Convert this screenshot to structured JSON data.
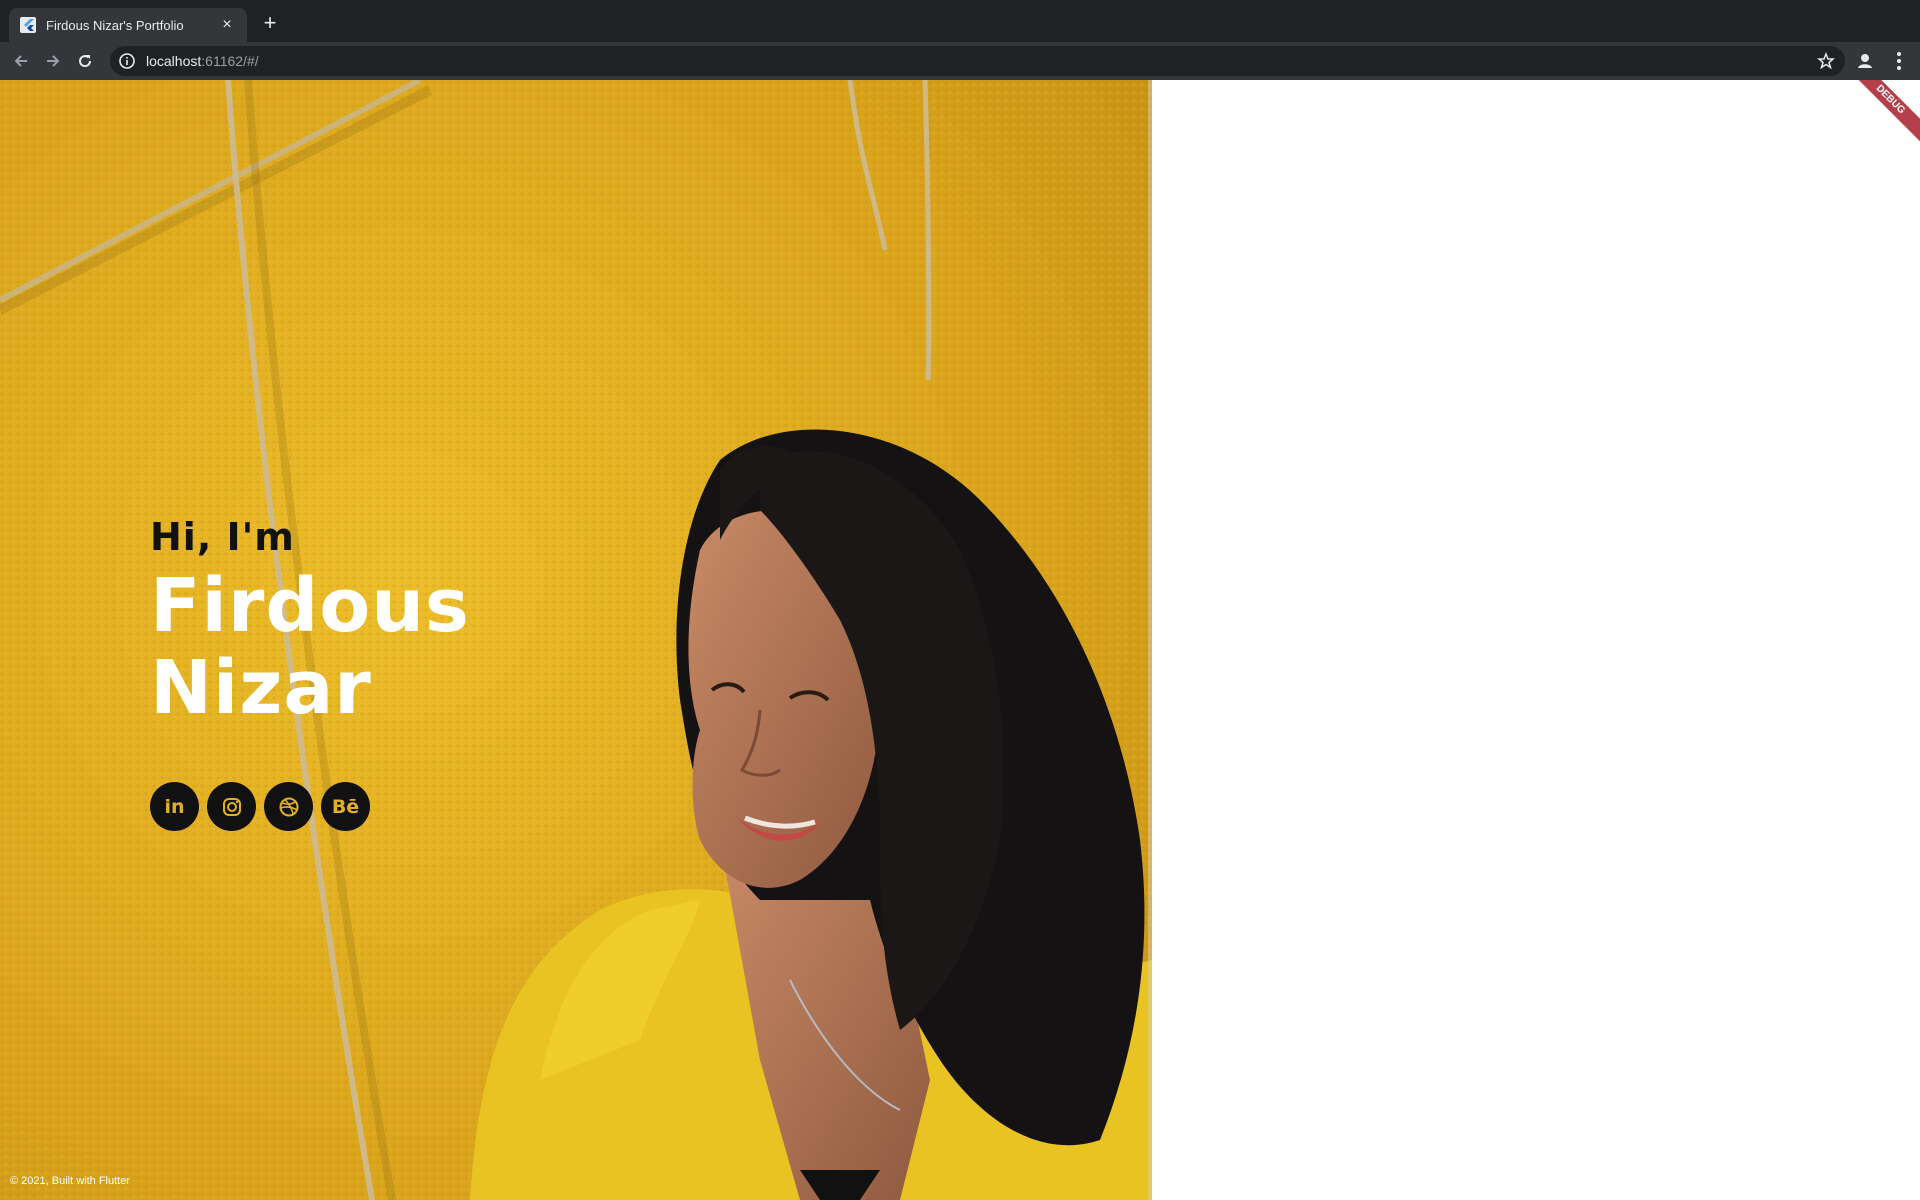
{
  "browser": {
    "tab_title": "Firdous Nizar's Portfolio",
    "tab_close": "×",
    "new_tab": "+",
    "url_host": "localhost",
    "url_rest": ":61162/#/"
  },
  "hero": {
    "greeting": "Hi, I'm",
    "first_name": "Firdous",
    "last_name": "Nizar",
    "socials": [
      {
        "label": "in",
        "icon": "linkedin-icon"
      },
      {
        "label": "",
        "icon": "instagram-icon"
      },
      {
        "label": "",
        "icon": "dribbble-icon"
      },
      {
        "label": "Bē",
        "icon": "behance-icon"
      }
    ]
  },
  "footer": {
    "text": "© 2021, Built with Flutter"
  },
  "debug_banner": "DEBUG",
  "colors": {
    "accent_yellow": "#e0ad1f",
    "dark": "#111111",
    "debug_red": "#b3404a"
  }
}
